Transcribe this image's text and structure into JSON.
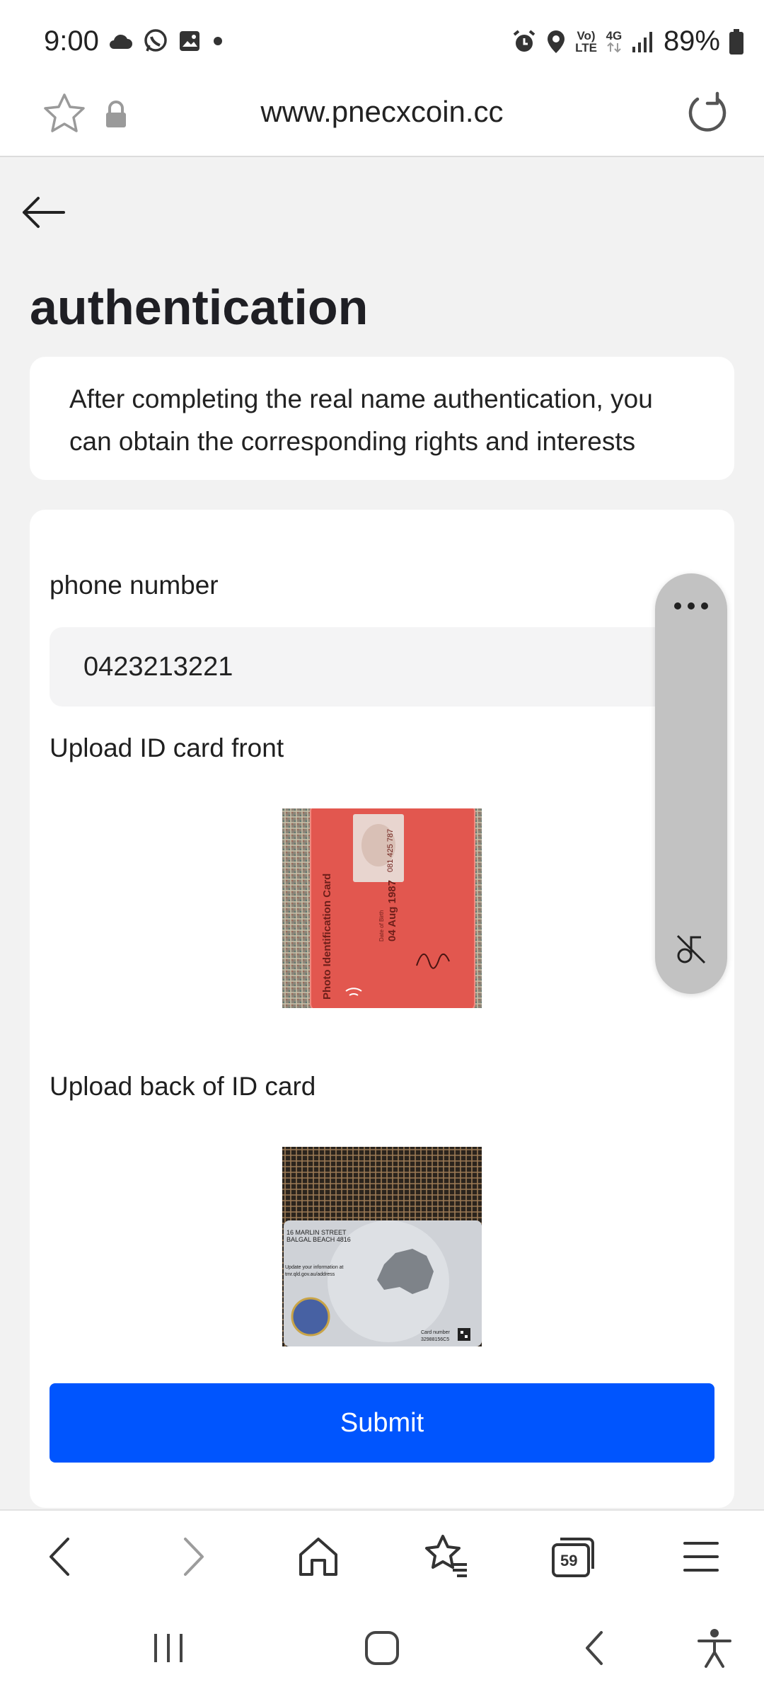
{
  "status_bar": {
    "time": "9:00",
    "battery_percent": "89%",
    "network_badge_top": "Vo)",
    "network_badge_bottom": "LTE",
    "network_type": "4G",
    "left_icons": [
      "cloud-icon",
      "whatsapp-icon",
      "gallery-icon",
      "dot-icon"
    ],
    "right_icons": [
      "alarm-icon",
      "location-icon",
      "volte-icon",
      "4g-icon",
      "signal-icon",
      "battery-icon"
    ]
  },
  "browser": {
    "url": "www.pnecxcoin.cc",
    "tab_count": "59"
  },
  "page": {
    "title": "authentication",
    "notice": "After completing the real name authentication, you can obtain the corresponding rights and interests",
    "form": {
      "phone_label": "phone number",
      "phone_value": "0423213221",
      "front_label": "Upload ID card front",
      "back_label": "Upload back of ID card",
      "submit_label": "Submit"
    },
    "id_front_card": {
      "card_title": "Photo Identification Card",
      "dob_label": "Date of Birth",
      "dob": "04 Aug 1987",
      "card_no": "081 425 787"
    },
    "id_back_card": {
      "address_line1": "16 MARLIN STREET",
      "address_line2": "BALGAL BEACH 4816",
      "update_line1": "Update your information at",
      "update_line2": "tmr.qld.gov.au/address",
      "card_number_label": "Card number",
      "card_number": "32988156C5"
    }
  },
  "colors": {
    "submit_bg": "#0055fe",
    "page_bg": "#f2f2f2",
    "card_bg": "#ffffff",
    "id_front_accent": "#e2574f"
  }
}
